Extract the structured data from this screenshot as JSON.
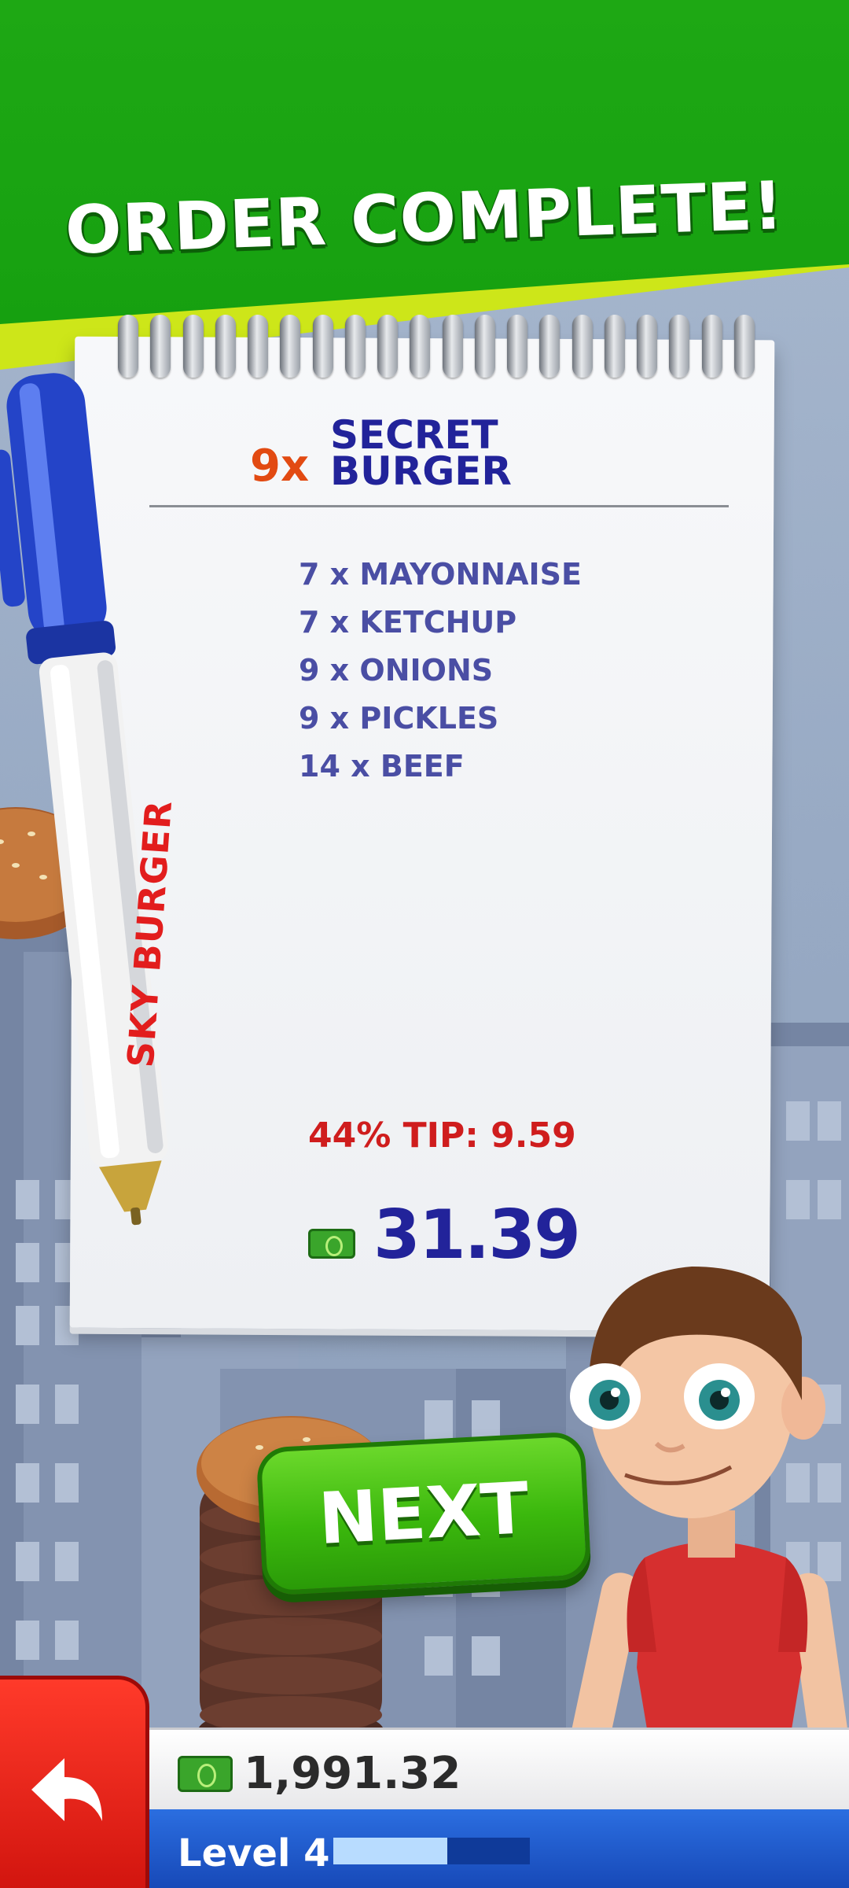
{
  "banner": {
    "title": "ORDER COMPLETE!"
  },
  "order": {
    "quantity": "9x",
    "name_line1": "SECRET",
    "name_line2": "BURGER",
    "ingredients": [
      "7 x MAYONNAISE",
      "7 x KETCHUP",
      "9 x ONIONS",
      "9 x PICKLES",
      "14 x BEEF"
    ],
    "tip": "44% TIP: 9.59",
    "total": "31.39"
  },
  "pen": {
    "brand": "SKY BURGER"
  },
  "buttons": {
    "next_label": "NEXT"
  },
  "hud": {
    "money": "1,991.32",
    "level_label": "Level 4",
    "level_progress": 0.58
  },
  "colors": {
    "banner_green": "#16a010",
    "banner_lime": "#cde619",
    "order_text": "#22239a",
    "ingredient_text": "#4a4ea4",
    "tip_text": "#cf1d1d",
    "quantity_text": "#e24a12"
  },
  "icons": [
    "money-icon",
    "back-arrow-icon",
    "pen-icon",
    "burger-bun-icon",
    "character-avatar"
  ]
}
